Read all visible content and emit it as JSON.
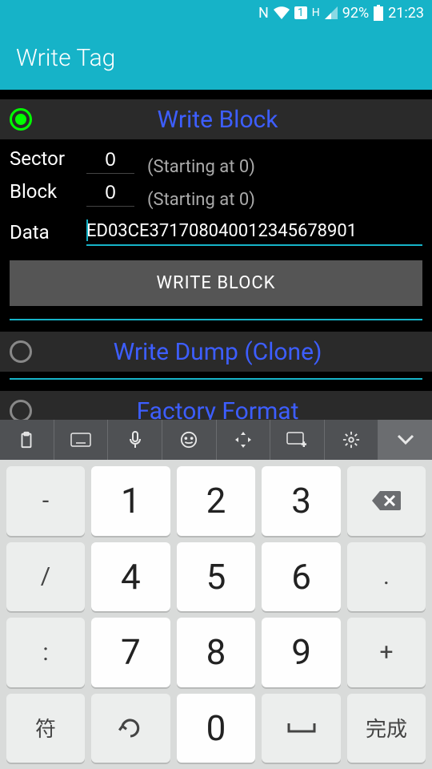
{
  "status": {
    "nfc": "N",
    "sim": "1",
    "network": "H",
    "battery_pct": "92%",
    "time": "21:23"
  },
  "title": "Write Tag",
  "sections": {
    "write_block": {
      "title": "Write Block",
      "selected": true,
      "sector_label": "Sector",
      "sector_value": "0",
      "sector_hint": "(Starting at 0)",
      "block_label": "Block",
      "block_value": "0",
      "block_hint": "(Starting at 0)",
      "data_label": "Data",
      "data_value": "ED03CE371708040012345678901",
      "button": "WRITE BLOCK"
    },
    "write_dump": {
      "title": "Write Dump (Clone)",
      "selected": false
    },
    "factory_format": {
      "title": "Factory Format",
      "selected": false
    }
  },
  "keyboard": {
    "toolbar": [
      "clipboard",
      "keyboard",
      "mic",
      "emoji",
      "move",
      "keyboard-settings",
      "gear",
      "collapse"
    ],
    "side_left": [
      "-",
      "/",
      ":",
      "+"
    ],
    "digits": [
      "1",
      "2",
      "3",
      "4",
      "5",
      "6",
      "7",
      "8",
      "9",
      "0"
    ],
    "side_right_backspace": "⌫",
    "bottom_left": "符",
    "bottom_undo": "↺",
    "bottom_period": ".",
    "bottom_space": "␣",
    "bottom_done": "完成"
  }
}
